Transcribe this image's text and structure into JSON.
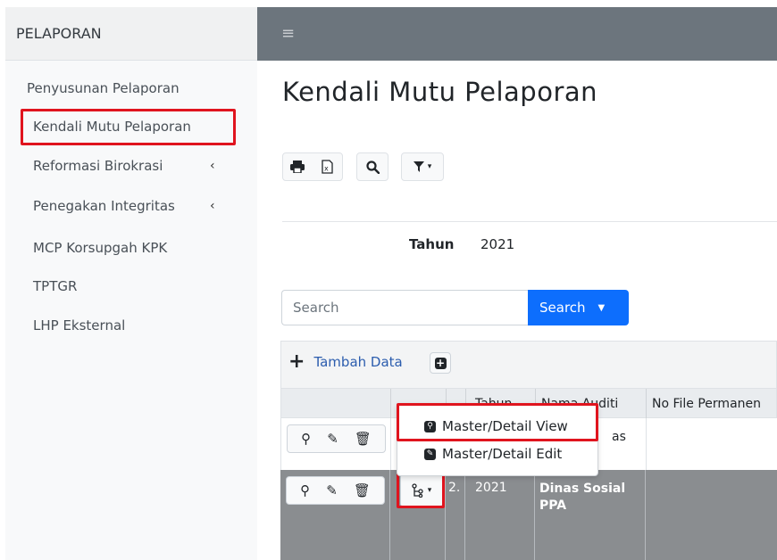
{
  "sidebar": {
    "title": "PELAPORAN",
    "items": [
      {
        "label": "Penyusunan Pelaporan",
        "has_submenu": false
      },
      {
        "label": "Kendali Mutu Pelaporan",
        "has_submenu": false,
        "active": true
      },
      {
        "label": "Reformasi Birokrasi",
        "has_submenu": true
      },
      {
        "label": "Penegakan Integritas",
        "has_submenu": true
      },
      {
        "label": "MCP Korsupgah KPK",
        "has_submenu": false
      },
      {
        "label": "TPTGR",
        "has_submenu": false
      },
      {
        "label": "LHP Eksternal",
        "has_submenu": false
      }
    ]
  },
  "topbar": {
    "menu_icon": "hamburger-icon"
  },
  "page": {
    "title": "Kendali Mutu Pelaporan"
  },
  "toolbar": {
    "icons": [
      "print-icon",
      "excel-icon",
      "search-icon",
      "filter-icon"
    ]
  },
  "filter": {
    "tahun_label": "Tahun",
    "tahun_value": "2021"
  },
  "search": {
    "placeholder": "Search",
    "button_label": "Search"
  },
  "grid": {
    "add_label": "Tambah Data",
    "columns": [
      "",
      "",
      "",
      "Tahun",
      "Nama Auditi",
      "No File Permanen"
    ],
    "rows": [
      {
        "no": "",
        "tahun": "",
        "nama_auditi": "as",
        "no_file": ""
      },
      {
        "no": "2.",
        "tahun": "2021",
        "nama_auditi": "Dinas Sosial PPA",
        "no_file": ""
      }
    ]
  },
  "dropdown": {
    "items": [
      {
        "label": "Master/Detail View",
        "icon": "master-detail-view-icon"
      },
      {
        "label": "Master/Detail Edit",
        "icon": "master-detail-edit-icon"
      }
    ]
  },
  "colors": {
    "highlight": "#e0141e",
    "primary": "#0d6efd",
    "topbar": "#6c757d",
    "selected_row": "#8a8d90"
  }
}
